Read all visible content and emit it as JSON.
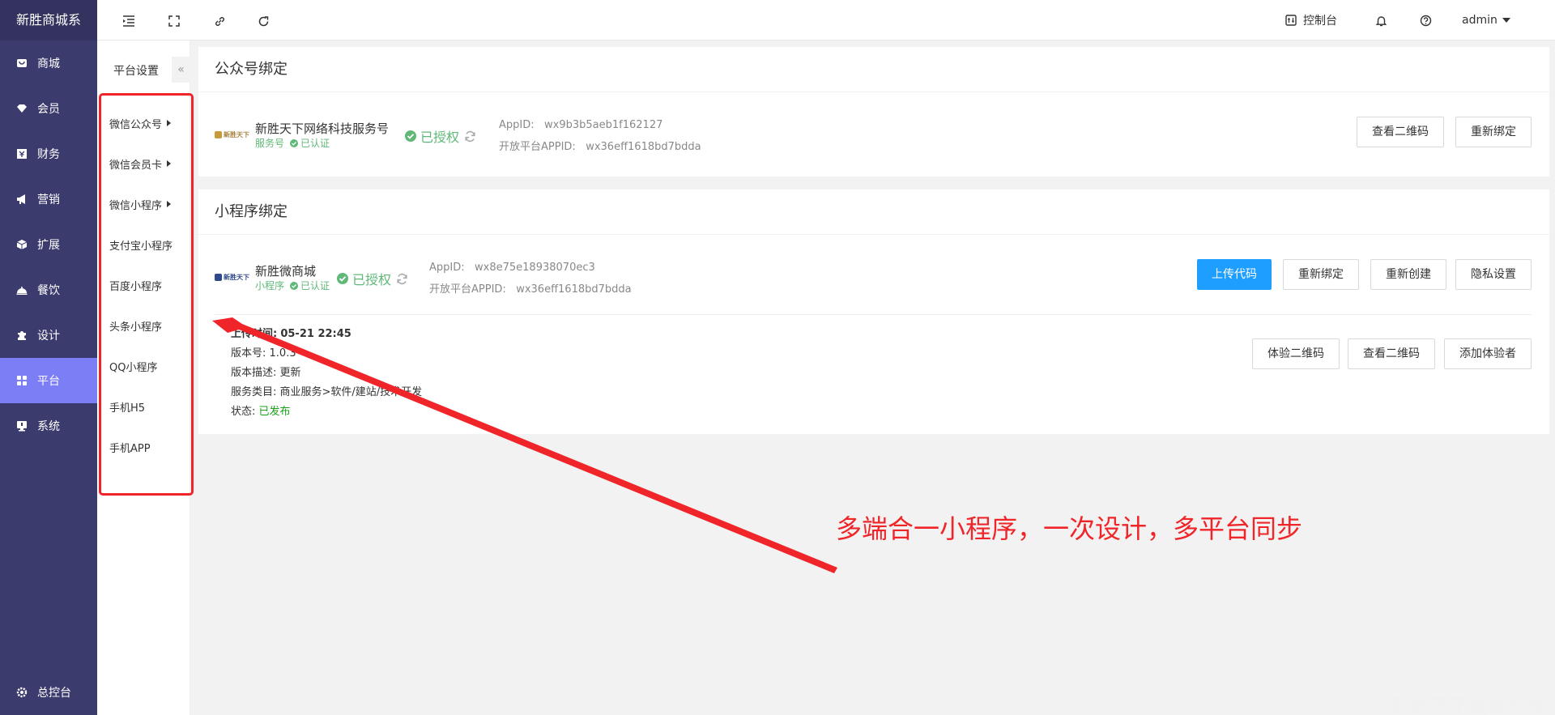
{
  "sidebar": {
    "brand": "新胜商城系",
    "items": [
      {
        "label": "商城",
        "icon": "shop-icon"
      },
      {
        "label": "会员",
        "icon": "member-icon"
      },
      {
        "label": "财务",
        "icon": "finance-icon"
      },
      {
        "label": "营销",
        "icon": "megaphone-icon"
      },
      {
        "label": "扩展",
        "icon": "cube-icon"
      },
      {
        "label": "餐饮",
        "icon": "dining-icon"
      },
      {
        "label": "设计",
        "icon": "puzzle-icon"
      },
      {
        "label": "平台",
        "icon": "grid-icon"
      },
      {
        "label": "系统",
        "icon": "monitor-icon"
      }
    ],
    "active_index": 7,
    "footer": "总控台"
  },
  "header": {
    "console": "控制台",
    "user": "admin"
  },
  "submenu": {
    "title": "平台设置",
    "collapse_glyph": "«",
    "items": [
      {
        "label": "微信公众号",
        "has_arrow": true
      },
      {
        "label": "微信会员卡",
        "has_arrow": true
      },
      {
        "label": "微信小程序",
        "has_arrow": true
      },
      {
        "label": "支付宝小程序",
        "has_arrow": false
      },
      {
        "label": "百度小程序",
        "has_arrow": false
      },
      {
        "label": "头条小程序",
        "has_arrow": false
      },
      {
        "label": "QQ小程序",
        "has_arrow": false
      },
      {
        "label": "手机H5",
        "has_arrow": false
      },
      {
        "label": "手机APP",
        "has_arrow": false
      }
    ]
  },
  "official": {
    "title": "公众号绑定",
    "logo_text": "新胜天下",
    "name": "新胜天下网络科技服务号",
    "type": "服务号",
    "verified": "已认证",
    "auth": "已授权",
    "appid_label": "AppID:",
    "appid": "wx9b3b5aeb1f162127",
    "open_label": "开放平台APPID:",
    "open_appid": "wx36eff1618bd7bdda",
    "btn_qr": "查看二维码",
    "btn_rebind": "重新绑定"
  },
  "mini": {
    "title": "小程序绑定",
    "logo_text": "新胜天下",
    "name": "新胜微商城",
    "type": "小程序",
    "verified": "已认证",
    "auth": "已授权",
    "appid_label": "AppID:",
    "appid": "wx8e75e18938070ec3",
    "open_label": "开放平台APPID:",
    "open_appid": "wx36eff1618bd7bdda",
    "btn_upload": "上传代码",
    "btn_rebind": "重新绑定",
    "btn_recreate": "重新创建",
    "btn_privacy": "隐私设置",
    "upload_label": "上传时间:",
    "upload_time": "05-21 22:45",
    "version_label": "版本号:",
    "version": "1.0.3",
    "desc_label": "版本描述:",
    "desc": "更新",
    "cat_label": "服务类目:",
    "category": "商业服务>软件/建站/技术开发",
    "status_label": "状态:",
    "status": "已发布",
    "btn_exp_qr": "体验二维码",
    "btn_view_qr": "查看二维码",
    "btn_add_tester": "添加体验者"
  },
  "annotation": "多端合一小程序，一次设计，多平台同步",
  "watermark": "新胜天下网络科技",
  "colors": {
    "sidebar": "#3c3b6e",
    "active": "#7b7ef4",
    "primary": "#1e9fff",
    "success": "#5fb878",
    "annotation": "#f0252a"
  }
}
